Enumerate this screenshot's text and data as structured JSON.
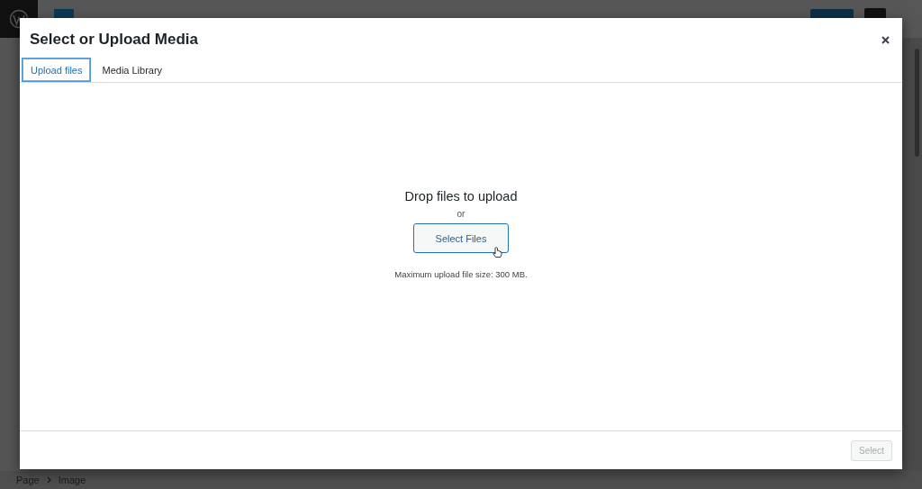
{
  "editor": {
    "breadcrumb": [
      "Page",
      "Image"
    ]
  },
  "modal": {
    "title": "Select or Upload Media",
    "tabs": [
      {
        "label": "Upload files",
        "selected": true
      },
      {
        "label": "Media Library",
        "selected": false
      }
    ],
    "upload": {
      "heading": "Drop files to upload",
      "or": "or",
      "button": "Select Files",
      "note": "Maximum upload file size: 300 MB."
    },
    "footer": {
      "button": {
        "label": "Select",
        "disabled": true
      }
    }
  }
}
